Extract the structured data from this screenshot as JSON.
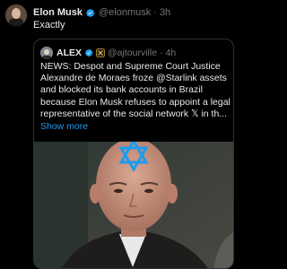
{
  "post": {
    "author_name": "Elon Musk",
    "author_handle": "@elonmusk",
    "separator": "·",
    "time": "3h",
    "text": "Exactly",
    "verified_icon": "verified-badge-icon",
    "colors": {
      "verified": "#1d9bf0",
      "muted": "#71767b"
    }
  },
  "quote": {
    "author_name": "ALEX",
    "author_handle": "@ajtourville",
    "separator": "·",
    "time": "4h",
    "badge_icons": [
      "verified-badge-icon",
      "gold-affiliate-badge-icon"
    ],
    "body_lines": [
      "NEWS: Despot and Supreme Court Justice",
      "Alexandre de Moraes froze @Starlink assets",
      "and blocked its bank accounts in Brazil",
      "because Elon Musk refuses to appoint a legal",
      "representative of the social network 𝕏 in th..."
    ],
    "show_more": "Show more",
    "image_icon": "star-of-david-icon",
    "colors": {
      "link": "#1d9bf0",
      "border": "#2f3336"
    }
  }
}
